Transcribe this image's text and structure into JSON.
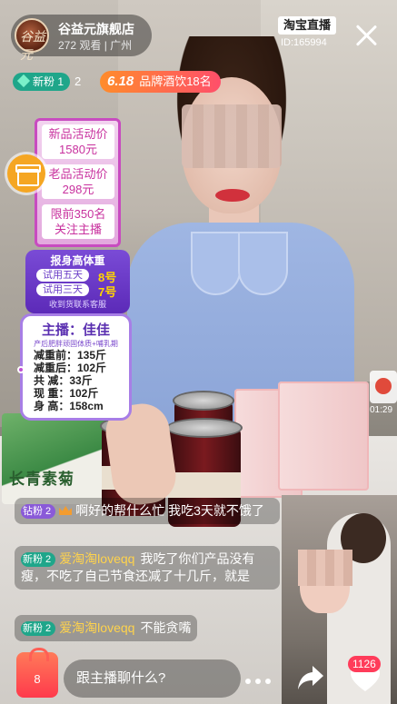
{
  "host": {
    "avatar_text": "谷益元",
    "name": "谷益元旗舰店",
    "meta": "272 观看 | 广州"
  },
  "platform": {
    "logo": "淘宝直播",
    "room_id": "ID:165994"
  },
  "fans_badge": {
    "label": "新粉 1",
    "count": "2"
  },
  "promo": {
    "prefix": "6.18",
    "text": "品牌酒饮18名"
  },
  "price_card": {
    "items": [
      {
        "line1": "新品活动价",
        "line2": "1580元"
      },
      {
        "line1": "老品活动价",
        "line2": "298元"
      },
      {
        "line1": "限前350名",
        "line2": "关注主播"
      }
    ]
  },
  "weigh_card": {
    "title": "报身高体重",
    "rows": [
      {
        "label": "试用五天",
        "value": "8号"
      },
      {
        "label": "试用三天",
        "value": "7号"
      }
    ],
    "footer": "收到货联系客服"
  },
  "anchor_card": {
    "title": "主播：佳佳",
    "subtitle": "产后肥胖顽固体质+哺乳期",
    "stats": [
      "减重前：135斤",
      "减重后：102斤",
      "共  减：33斤",
      "现  重：102斤",
      "身  高：158cm"
    ]
  },
  "side_time": "01:29",
  "products": {
    "green_box_text": "长青素菊"
  },
  "chat": [
    {
      "badge": "钻粉 2",
      "badge_color": "#8a5ad8",
      "crown": true,
      "user": "",
      "text": "啊好的帮什么忙  我吃3天就不饿了"
    },
    {
      "badge": "新粉 2",
      "badge_color": "#1fa68a",
      "crown": false,
      "user": "爱淘淘loveqq",
      "text": "我吃了你们产品没有瘦，不吃了自己节食还减了十几斤，就是"
    },
    {
      "badge": "新粉 2",
      "badge_color": "#1fa68a",
      "crown": false,
      "user": "爱淘淘loveqq",
      "text": "不能贪嘴"
    }
  ],
  "bottom": {
    "cart_count": "8",
    "input_placeholder": "跟主播聊什么?",
    "likes": "1126"
  },
  "icons": [
    "gift-icon",
    "close-icon",
    "cart-icon",
    "more-icon",
    "share-icon",
    "like-icon",
    "crown-icon",
    "gem-icon"
  ]
}
